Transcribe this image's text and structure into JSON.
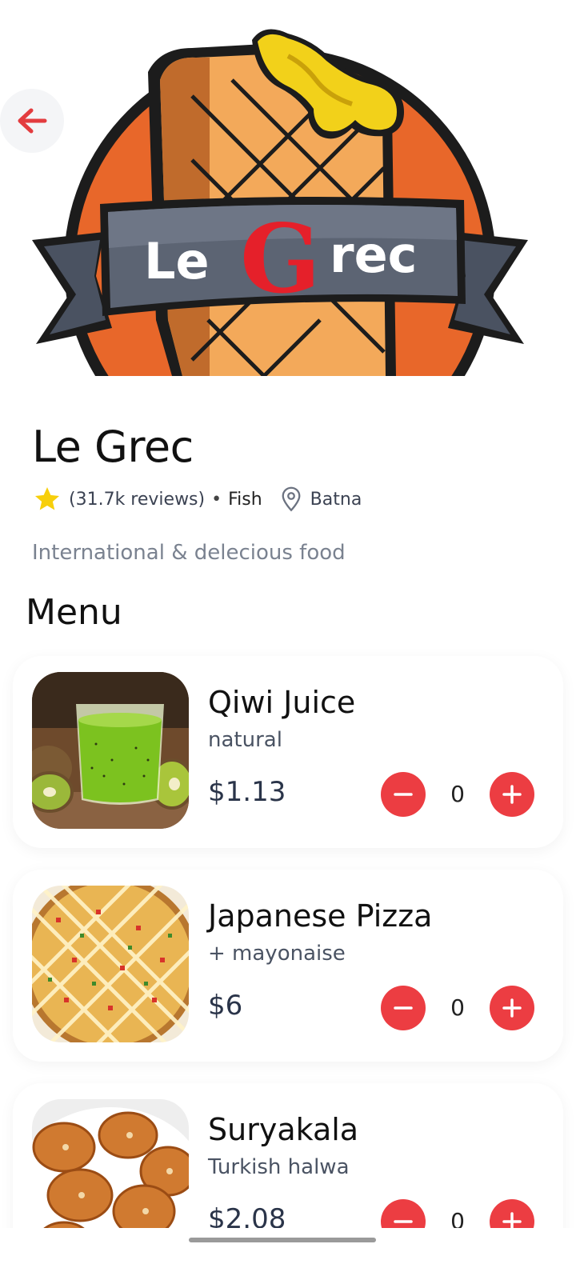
{
  "restaurant": {
    "logo_text_le": "Le",
    "logo_text_g": "G",
    "logo_text_rec": "rec",
    "name": "Le Grec",
    "reviews": "(31.7k reviews)",
    "separator": "•",
    "category": "Fish",
    "location": "Batna",
    "description": "International & delecious food",
    "rating_icon": "star-icon",
    "location_icon": "map-pin-icon"
  },
  "menu": {
    "title": "Menu",
    "items": [
      {
        "name": "Qiwi Juice",
        "subtitle": "natural",
        "price": "$1.13",
        "quantity": "0"
      },
      {
        "name": "Japanese Pizza",
        "subtitle": "+ mayonaise",
        "price": "$6",
        "quantity": "0"
      },
      {
        "name": "Suryakala",
        "subtitle": "Turkish halwa",
        "price": "$2.08",
        "quantity": "0"
      }
    ]
  },
  "colors": {
    "accent": "#ec3d42",
    "star": "#f7cf0b",
    "muted_text": "#7a8290"
  },
  "icons": {
    "back": "arrow-left-icon",
    "minus": "minus-icon",
    "plus": "plus-icon"
  }
}
